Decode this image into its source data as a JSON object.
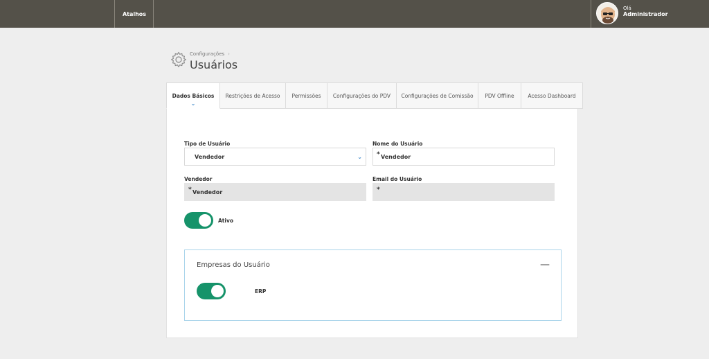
{
  "topbar": {
    "shortcuts_label": "Atalhos",
    "greeting": "Olá",
    "user_name": "Administrador"
  },
  "header": {
    "breadcrumb": "Configurações",
    "breadcrumb_sep": "›",
    "title": "Usuários"
  },
  "tabs": [
    {
      "label": "Dados Básicos",
      "active": true
    },
    {
      "label": "Restrições de Acesso"
    },
    {
      "label": "Permissões"
    },
    {
      "label": "Configurações do PDV"
    },
    {
      "label": "Configurações de Comissão"
    },
    {
      "label": "PDV Offline"
    },
    {
      "label": "Acesso Dashboard"
    }
  ],
  "form": {
    "tipo_label": "Tipo de Usuário",
    "tipo_value": "Vendedor",
    "nome_label": "Nome do Usuário",
    "nome_value": "Vendedor",
    "vendedor_label": "Vendedor",
    "vendedor_value": "Vendedor",
    "email_label": "Email do Usuário",
    "email_value": "",
    "required_mark": "*",
    "ativo_label": "Ativo",
    "ativo_on": true
  },
  "empresas": {
    "title": "Empresas do Usuário",
    "collapse_symbol": "—",
    "items": [
      {
        "label": "ERP",
        "on": true
      }
    ]
  },
  "colors": {
    "topbar": "#545149",
    "toggle_on": "#16936a",
    "accent": "#3a86c8"
  }
}
